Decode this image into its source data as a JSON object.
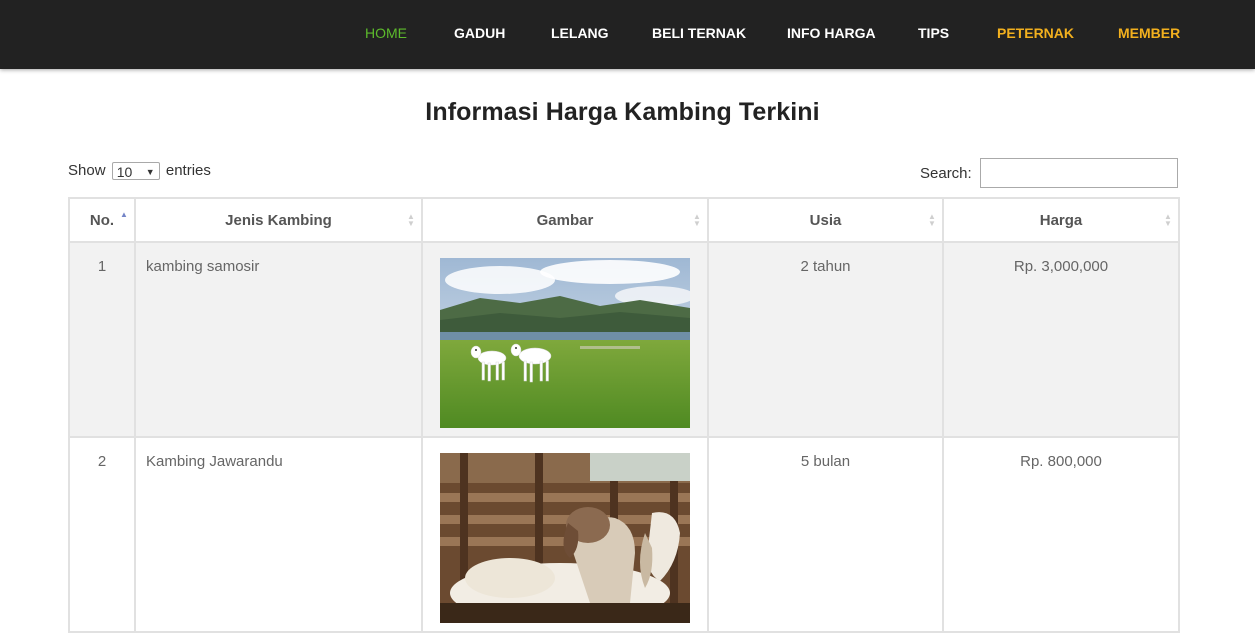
{
  "nav": {
    "items": [
      {
        "label": "HOME",
        "style": "active"
      },
      {
        "label": "GADUH",
        "style": "normal"
      },
      {
        "label": "LELANG",
        "style": "normal"
      },
      {
        "label": "BELI TERNAK",
        "style": "normal"
      },
      {
        "label": "INFO HARGA",
        "style": "normal"
      },
      {
        "label": "TIPS",
        "style": "normal"
      },
      {
        "label": "PETERNAK",
        "style": "accent"
      },
      {
        "label": "MEMBER",
        "style": "accent"
      }
    ]
  },
  "page": {
    "title": "Informasi Harga Kambing Terkini"
  },
  "controls": {
    "show_label": "Show",
    "entries_value": "10",
    "entries_label": "entries",
    "search_label": "Search:",
    "search_value": ""
  },
  "table": {
    "headers": [
      "No.",
      "Jenis Kambing",
      "Gambar",
      "Usia",
      "Harga"
    ],
    "rows": [
      {
        "no": "1",
        "jenis": "kambing samosir",
        "image": "goat-photo-lake-meadow",
        "usia": "2 tahun",
        "harga": "Rp. 3,000,000"
      },
      {
        "no": "2",
        "jenis": "Kambing Jawarandu",
        "image": "goat-photo-barn-pen",
        "usia": "5 bulan",
        "harga": "Rp. 800,000"
      }
    ]
  },
  "colors": {
    "navbar_bg": "#222222",
    "nav_active": "#5dbb2c",
    "nav_accent": "#f2b01e",
    "row_stripe": "#f2f2f2"
  }
}
